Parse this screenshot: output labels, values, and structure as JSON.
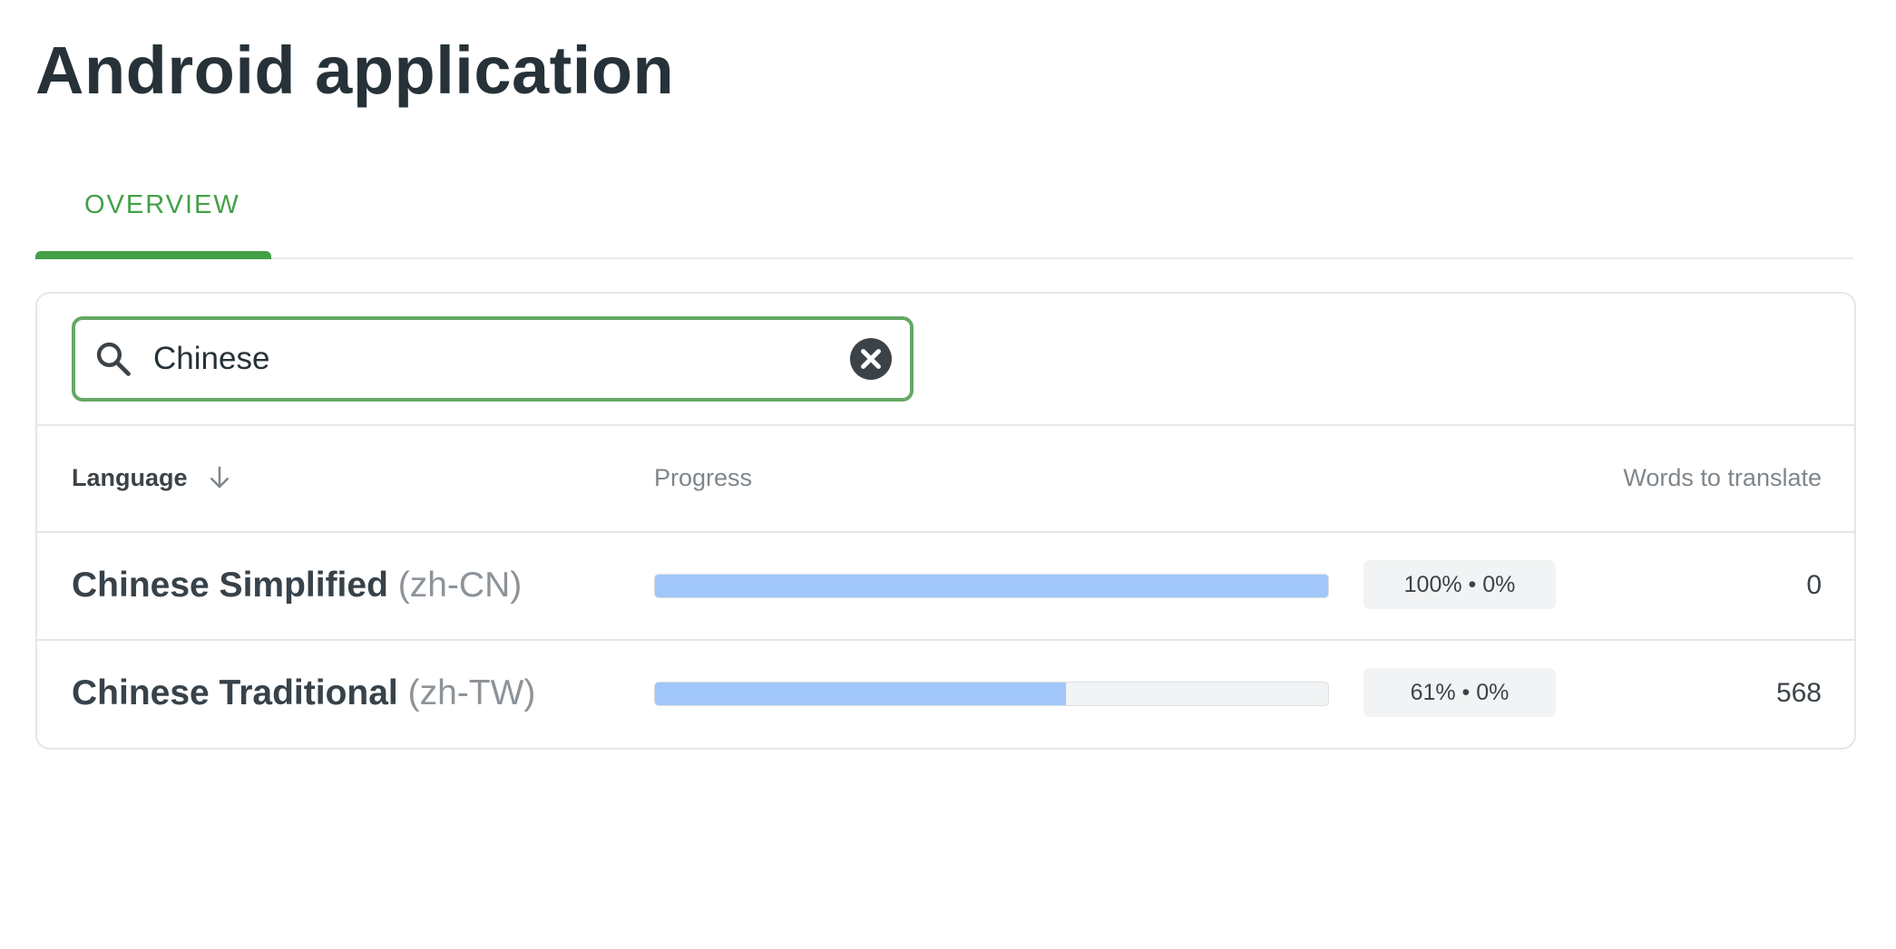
{
  "page": {
    "title": "Android application"
  },
  "tabs": [
    {
      "label": "OVERVIEW",
      "active": true
    }
  ],
  "search": {
    "value": "Chinese",
    "placeholder": ""
  },
  "table": {
    "headers": {
      "language": "Language",
      "progress": "Progress",
      "words": "Words to translate"
    },
    "sort": {
      "column": "language",
      "direction": "descending",
      "icon": "arrow-down-icon"
    },
    "rows": [
      {
        "name": "Chinese Simplified",
        "code": "(zh-CN)",
        "progress": 1.0,
        "badge": "100% • 0%",
        "words": "0"
      },
      {
        "name": "Chinese Traditional",
        "code": "(zh-TW)",
        "progress": 0.61,
        "badge": "61% • 0%",
        "words": "568"
      }
    ]
  },
  "colors": {
    "accent": "#43a047",
    "search_border": "#66a866",
    "progress_fill": "#a1c6f9",
    "progress_track": "#f1f3f4",
    "text_primary": "#263238"
  },
  "icons": {
    "search": "search-icon",
    "clear": "clear-icon",
    "sort": "arrow-down-icon"
  }
}
